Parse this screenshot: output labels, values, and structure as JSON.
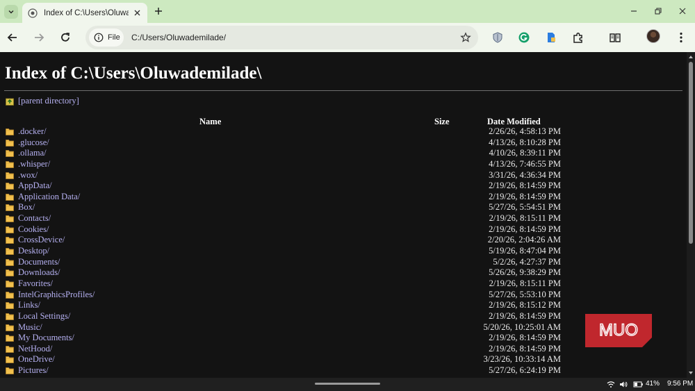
{
  "browser": {
    "tab_title": "Index of C:\\Users\\Oluwadem",
    "address_chip_label": "File",
    "url": "C:/Users/Oluwademilade/"
  },
  "page": {
    "heading": "Index of C:\\Users\\Oluwademilade\\",
    "parent_link": "[parent directory]",
    "columns": {
      "name": "Name",
      "size": "Size",
      "date": "Date Modified"
    },
    "entries": [
      {
        "name": ".docker/",
        "date": "2/26/26, 4:58:13 PM"
      },
      {
        "name": ".glucose/",
        "date": "4/13/26, 8:10:28 PM"
      },
      {
        "name": ".ollama/",
        "date": "4/10/26, 8:39:11 PM"
      },
      {
        "name": ".whisper/",
        "date": "4/13/26, 7:46:55 PM"
      },
      {
        "name": ".wox/",
        "date": "3/31/26, 4:36:34 PM"
      },
      {
        "name": "AppData/",
        "date": "2/19/26, 8:14:59 PM"
      },
      {
        "name": "Application Data/",
        "date": "2/19/26, 8:14:59 PM"
      },
      {
        "name": "Box/",
        "date": "5/27/26, 5:54:51 PM"
      },
      {
        "name": "Contacts/",
        "date": "2/19/26, 8:15:11 PM"
      },
      {
        "name": "Cookies/",
        "date": "2/19/26, 8:14:59 PM"
      },
      {
        "name": "CrossDevice/",
        "date": "2/20/26, 2:04:26 AM"
      },
      {
        "name": "Desktop/",
        "date": "5/19/26, 8:47:04 PM"
      },
      {
        "name": "Documents/",
        "date": "5/2/26, 4:27:37 PM"
      },
      {
        "name": "Downloads/",
        "date": "5/26/26, 9:38:29 PM"
      },
      {
        "name": "Favorites/",
        "date": "2/19/26, 8:15:11 PM"
      },
      {
        "name": "IntelGraphicsProfiles/",
        "date": "5/27/26, 5:53:10 PM"
      },
      {
        "name": "Links/",
        "date": "2/19/26, 8:15:12 PM"
      },
      {
        "name": "Local Settings/",
        "date": "2/19/26, 8:14:59 PM"
      },
      {
        "name": "Music/",
        "date": "5/20/26, 10:25:01 AM"
      },
      {
        "name": "My Documents/",
        "date": "2/19/26, 8:14:59 PM"
      },
      {
        "name": "NetHood/",
        "date": "2/19/26, 8:14:59 PM"
      },
      {
        "name": "OneDrive/",
        "date": "3/23/26, 10:33:14 AM"
      },
      {
        "name": "Pictures/",
        "date": "5/27/26, 6:24:19 PM"
      }
    ]
  },
  "watermark": {
    "text": "MUO"
  },
  "taskbar": {
    "battery": "41%",
    "time": "9:56 PM"
  },
  "colors": {
    "tabstrip": "#cde9c0",
    "toolbar": "#f1f6ed",
    "page_bg": "#131313",
    "link": "#b6b1f2",
    "folder": "#f2c14e",
    "watermark": "#c0272d"
  },
  "icons": {
    "tab_search": "chevron-down-icon",
    "favicon": "globe-icon",
    "parent": "up-folder-icon",
    "entry": "folder-icon"
  }
}
